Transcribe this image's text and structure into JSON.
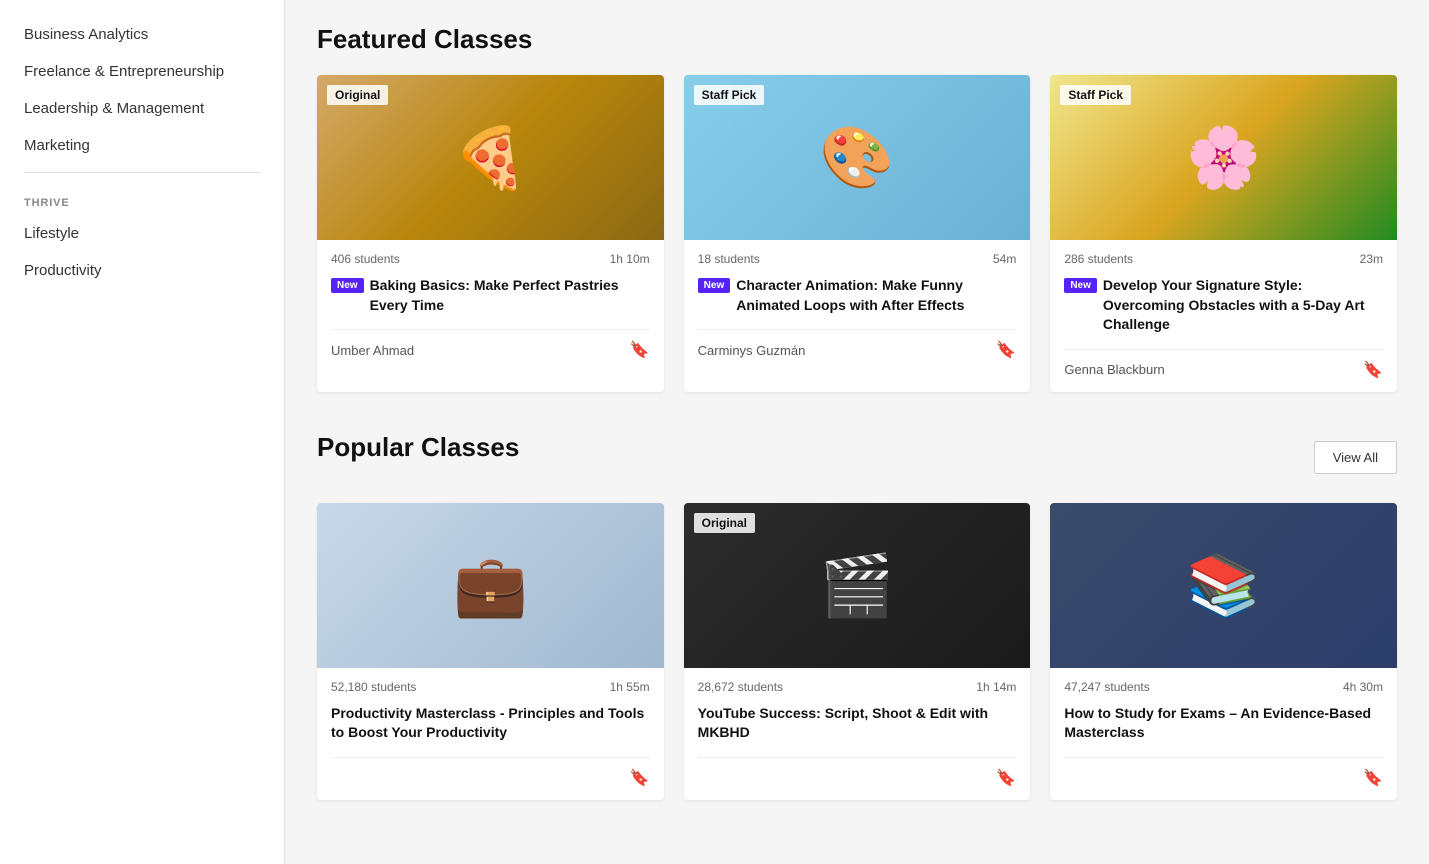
{
  "sidebar": {
    "items": [
      {
        "id": "business-analytics",
        "label": "Business Analytics"
      },
      {
        "id": "freelance-entrepreneurship",
        "label": "Freelance & Entrepreneurship"
      },
      {
        "id": "leadership-management",
        "label": "Leadership & Management"
      },
      {
        "id": "marketing",
        "label": "Marketing"
      }
    ],
    "thrive_section": "THRIVE",
    "thrive_items": [
      {
        "id": "lifestyle",
        "label": "Lifestyle"
      },
      {
        "id": "productivity",
        "label": "Productivity"
      }
    ]
  },
  "featured": {
    "title": "Featured Classes",
    "cards": [
      {
        "id": "baking-basics",
        "badge": "Original",
        "thumb_class": "thumb-baking",
        "students": "406 students",
        "duration": "1h 10m",
        "is_new": true,
        "new_label": "New",
        "title": "Baking Basics: Make Perfect Pastries Every Time",
        "author": "Umber Ahmad"
      },
      {
        "id": "character-animation",
        "badge": "Staff Pick",
        "thumb_class": "thumb-animation",
        "students": "18 students",
        "duration": "54m",
        "is_new": true,
        "new_label": "New",
        "title": "Character Animation: Make Funny Animated Loops with After Effects",
        "author": "Carminys Guzmán"
      },
      {
        "id": "signature-style",
        "badge": "Staff Pick",
        "thumb_class": "thumb-art",
        "students": "286 students",
        "duration": "23m",
        "is_new": true,
        "new_label": "New",
        "title": "Develop Your Signature Style: Overcoming Obstacles with a 5-Day Art Challenge",
        "author": "Genna Blackburn"
      }
    ]
  },
  "popular": {
    "title": "Popular Classes",
    "view_all_label": "View All",
    "cards": [
      {
        "id": "productivity-masterclass",
        "badge": null,
        "thumb_class": "thumb-productivity",
        "students": "52,180 students",
        "duration": "1h 55m",
        "is_new": false,
        "title": "Productivity Masterclass - Principles and Tools to Boost Your Productivity",
        "author": ""
      },
      {
        "id": "youtube-success",
        "badge": "Original",
        "thumb_class": "thumb-youtube",
        "students": "28,672 students",
        "duration": "1h 14m",
        "is_new": false,
        "title": "YouTube Success: Script, Shoot & Edit with MKBHD",
        "author": ""
      },
      {
        "id": "study-exams",
        "badge": null,
        "thumb_class": "thumb-study",
        "students": "47,247 students",
        "duration": "4h 30m",
        "is_new": false,
        "title": "How to Study for Exams – An Evidence-Based Masterclass",
        "author": ""
      }
    ]
  }
}
